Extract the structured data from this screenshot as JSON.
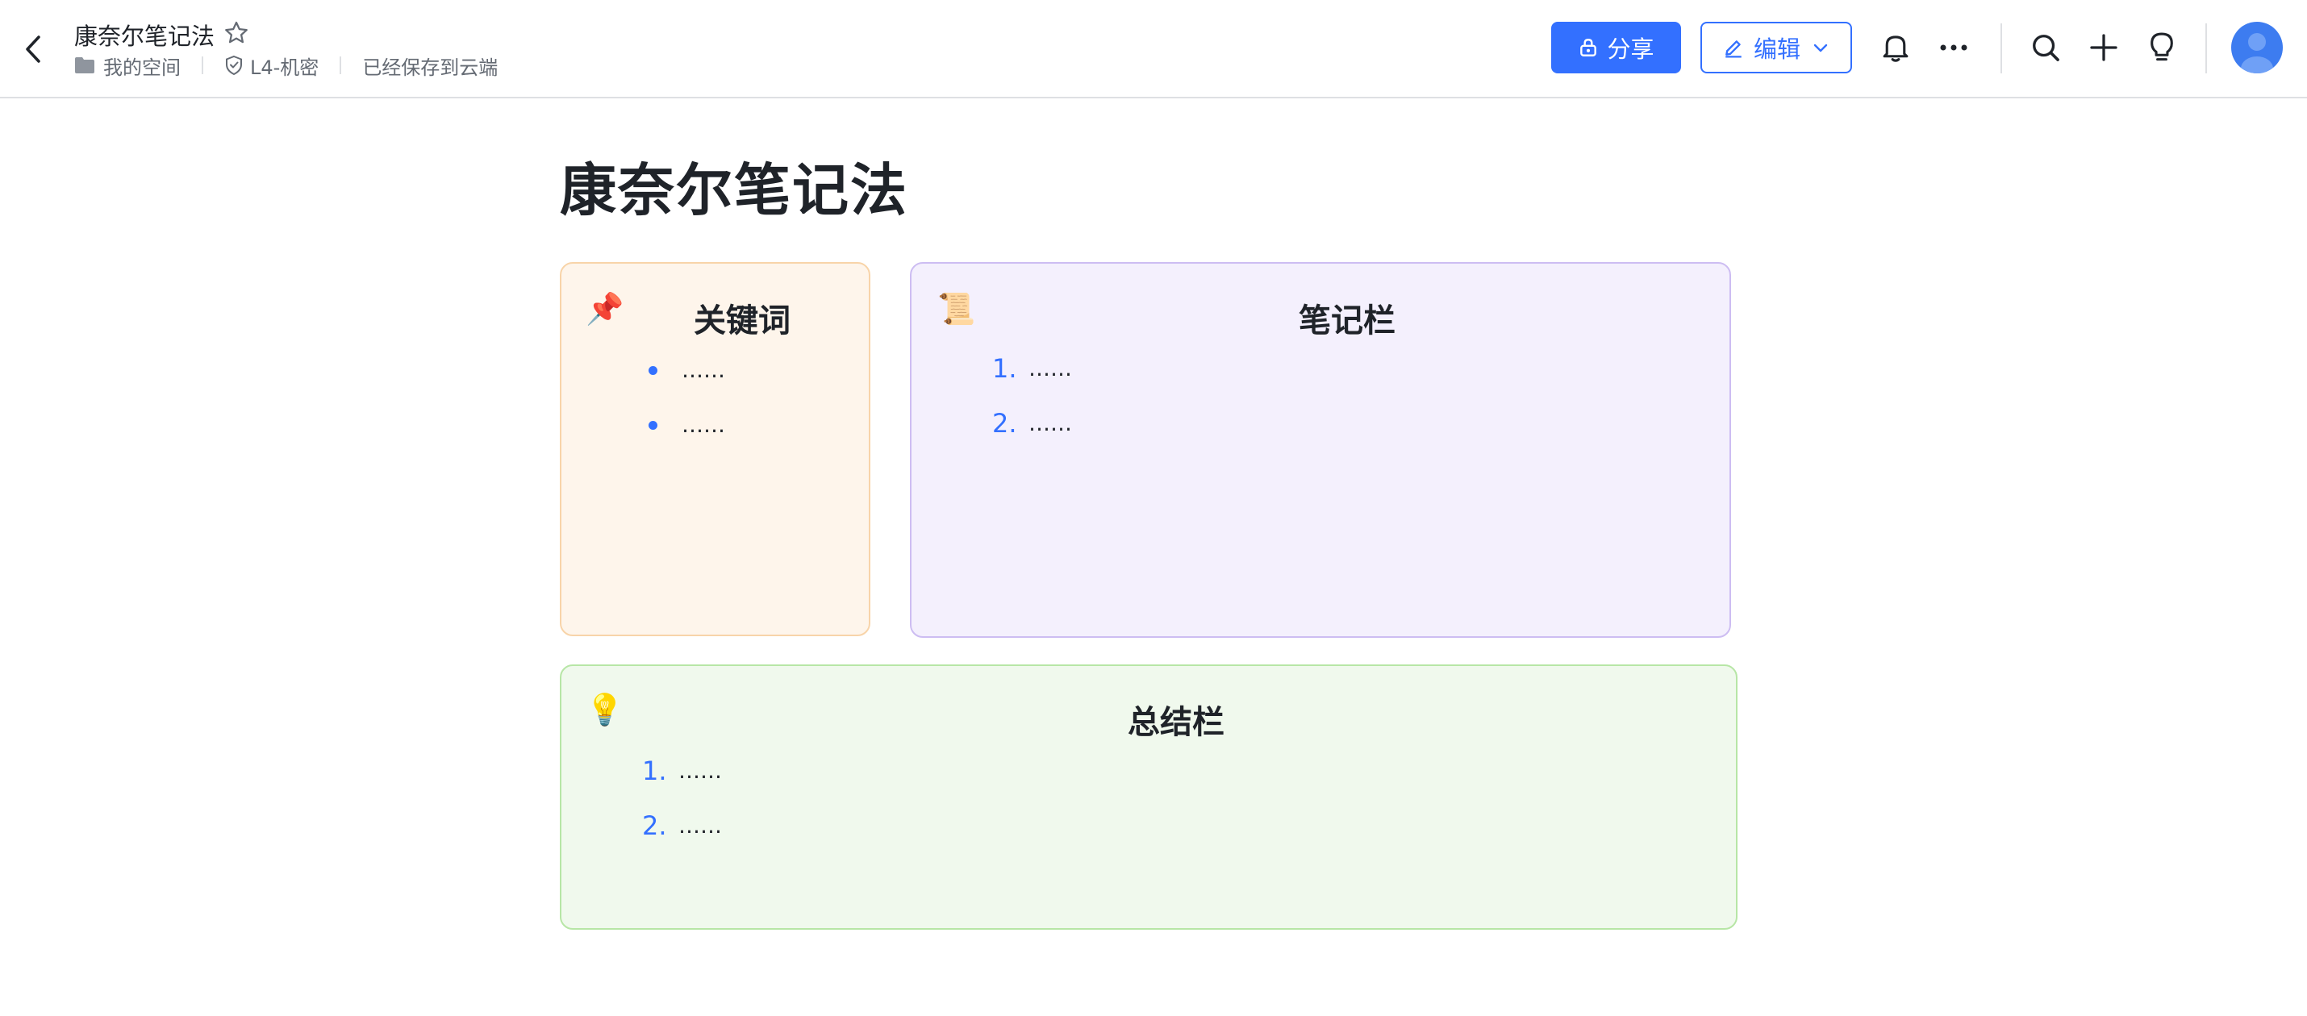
{
  "header": {
    "doc_title": "康奈尔笔记法",
    "meta": {
      "location": "我的空间",
      "security_level": "L4-机密",
      "save_status": "已经保存到云端"
    },
    "share_label": "分享",
    "edit_label": "编辑",
    "icons": [
      "back-arrow-icon",
      "star-icon",
      "bell-icon",
      "more-icon",
      "search-icon",
      "plus-icon",
      "lightbulb-icon",
      "avatar"
    ],
    "accent_color": "#3370ff"
  },
  "page": {
    "title": "康奈尔笔记法",
    "keywords_card": {
      "emoji": "📌",
      "title": "关键词",
      "items": [
        "……",
        "……"
      ]
    },
    "notes_card": {
      "emoji": "📜",
      "title": "笔记栏",
      "items": [
        {
          "marker": "1.",
          "text": "……"
        },
        {
          "marker": "2.",
          "text": "……"
        }
      ]
    },
    "summary_card": {
      "emoji": "💡",
      "title": "总结栏",
      "items": [
        {
          "marker": "1.",
          "text": "……"
        },
        {
          "marker": "2.",
          "text": "……"
        }
      ]
    }
  },
  "colors": {
    "keywords_bg": "#fef5eb",
    "keywords_border": "#f8d4a9",
    "notes_bg": "#f4f0fd",
    "notes_border": "#cdbdf2",
    "summary_bg": "#f0f9ed",
    "summary_border": "#b7e6a6"
  }
}
